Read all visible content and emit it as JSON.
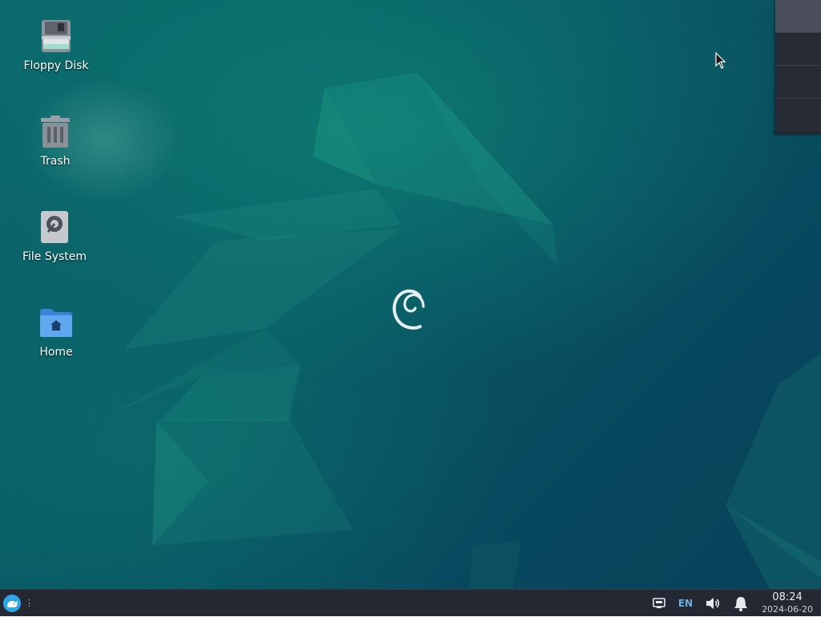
{
  "desktop": {
    "icons": [
      {
        "label": "Floppy Disk",
        "icon": "floppy-disk-icon"
      },
      {
        "label": "Trash",
        "icon": "trash-icon"
      },
      {
        "label": "File System",
        "icon": "hard-drive-icon"
      },
      {
        "label": "Home",
        "icon": "home-folder-icon"
      }
    ],
    "wallpaper_logo": "debian-swirl-icon"
  },
  "workspace_pager": {
    "workspaces": 4,
    "active_index": 0
  },
  "panel": {
    "menu_icon": "whisker-menu-icon",
    "tray": {
      "network_icon": "network-wired-icon",
      "keyboard_layout": "EN",
      "volume_icon": "volume-icon",
      "notifications_icon": "bell-icon"
    },
    "clock": {
      "time": "08:24",
      "date": "2024-06-20"
    }
  },
  "colors": {
    "panel_bg": "#232832",
    "desktop_accent": "#0b6a6c",
    "keyboard_accent": "#6fb0e6"
  }
}
